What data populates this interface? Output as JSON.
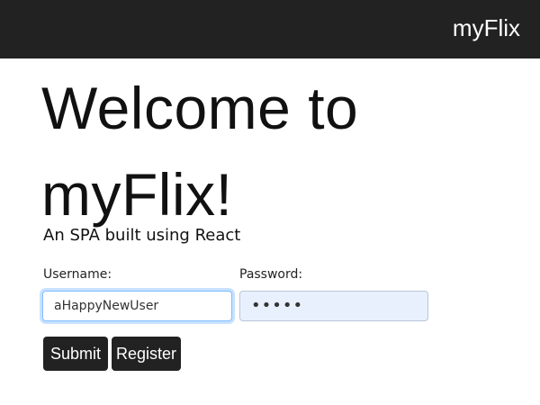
{
  "navbar": {
    "brand": "myFlix",
    "background": "#222222"
  },
  "main": {
    "title": "Welcome to myFlix!",
    "subtitle": "An SPA built using React"
  },
  "form": {
    "username": {
      "label": "Username:",
      "value": "aHappyNewUser",
      "focused": true
    },
    "password": {
      "label": "Password:",
      "value": "•••••",
      "autofilled": true
    },
    "submit_label": "Submit",
    "register_label": "Register"
  },
  "colors": {
    "button": "#222222",
    "focus_ring": "#80bdff",
    "autofill_background": "#e8f0fe"
  }
}
